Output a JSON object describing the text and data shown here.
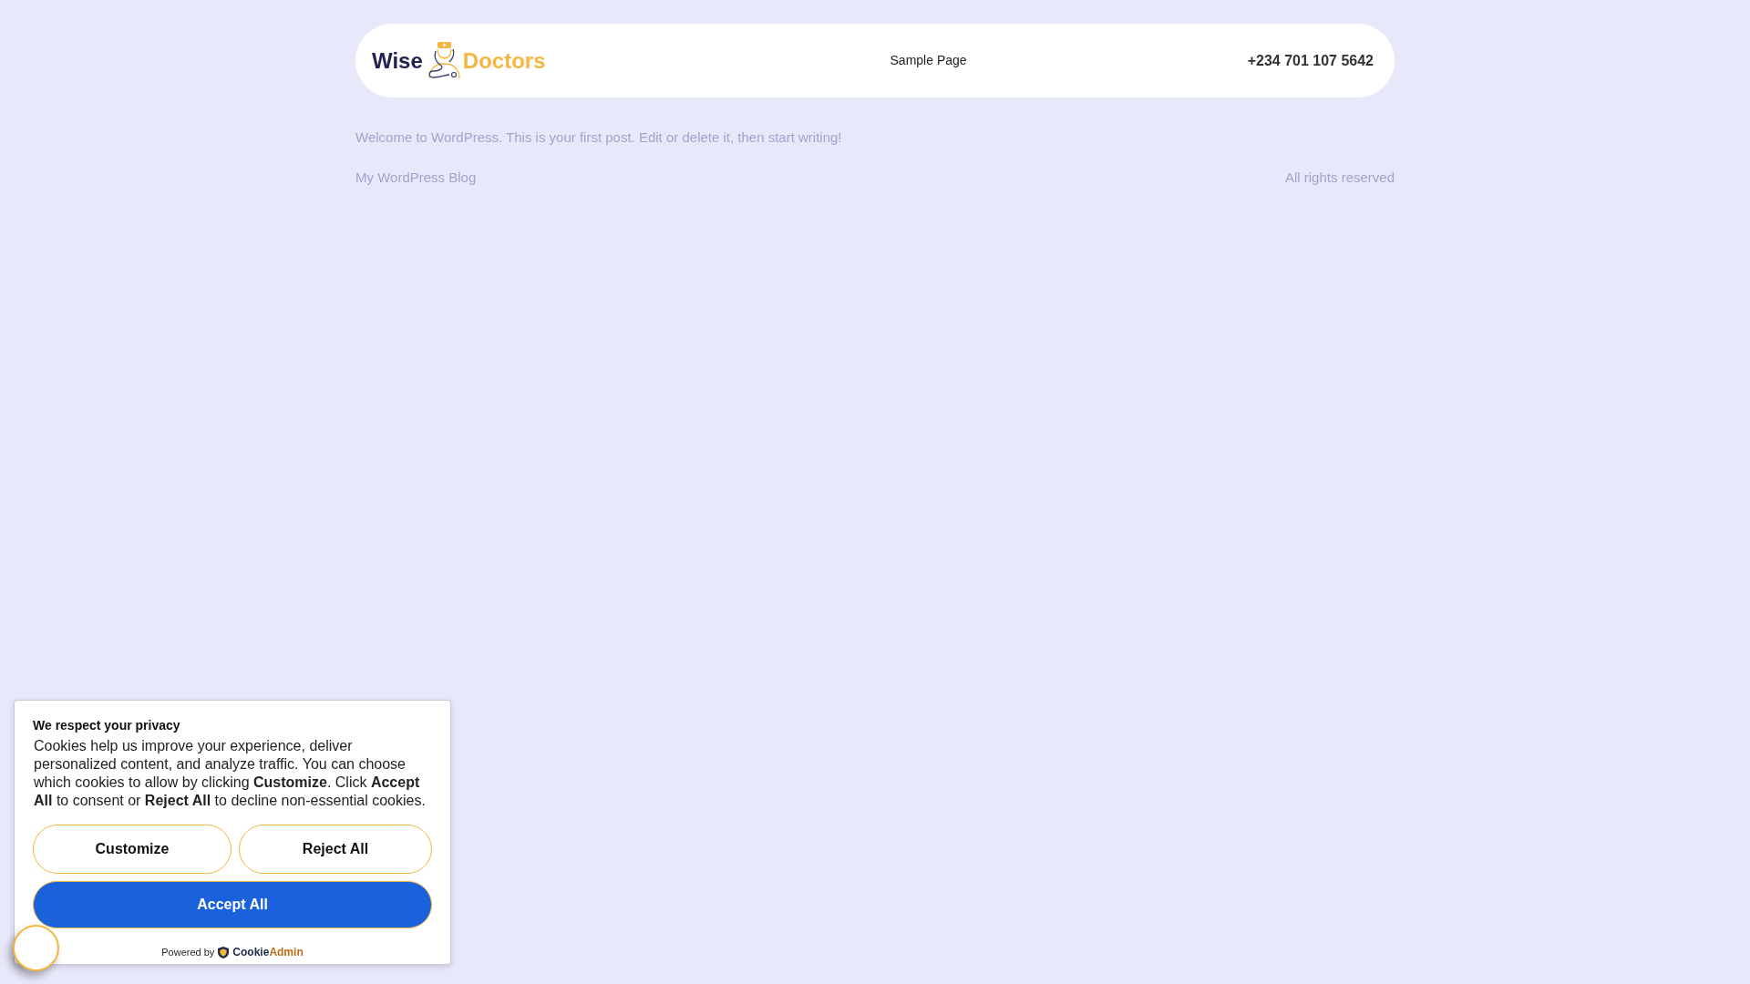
{
  "header": {
    "logo": [
      "Wise",
      "Doctors"
    ],
    "nav": [
      {
        "label": "Sample Page"
      }
    ],
    "phone": "+234 701 107 5642"
  },
  "post_excerpt": "Welcome to WordPress. This is your first post. Edit or delete it, then start writing!",
  "footer": {
    "site_name": "My WordPress Blog",
    "rights": "All rights reserved"
  },
  "cookie_banner": {
    "title": "We respect your privacy",
    "text": "Cookies help us improve your experience, deliver personalized content, and analyze traffic. You can choose which cookies to allow by clicking **Customize**. Click **Accept All** to consent or **Reject All** to decline non-essential cookies.",
    "buttons": [
      {
        "label": "Customize",
        "kind": "outline"
      },
      {
        "label": "Reject All",
        "kind": "outline"
      },
      {
        "label": "Accept All",
        "kind": "primary"
      }
    ],
    "powered_by": "Powered by",
    "brand": [
      "Cookie",
      "Admin"
    ]
  }
}
